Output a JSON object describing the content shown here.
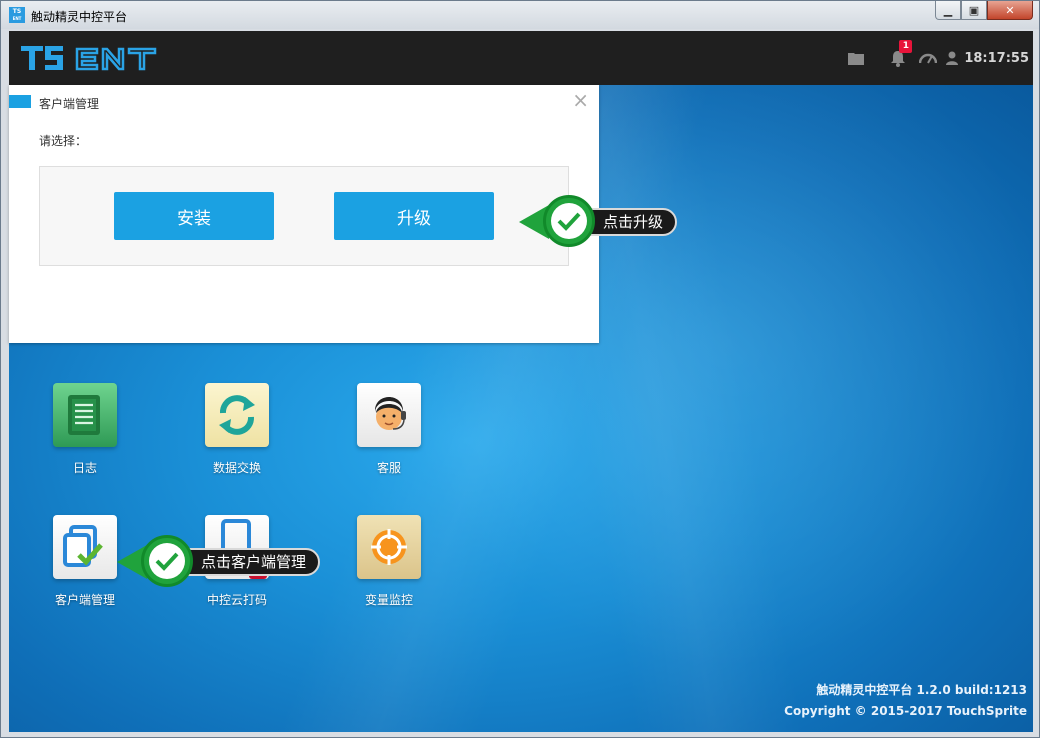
{
  "window": {
    "title": "触动精灵中控平台",
    "app_icon_text_top": "TS",
    "app_icon_text_bottom": "ENT"
  },
  "header": {
    "logo_text": "TS ENT",
    "notification_count": "1",
    "time": "18:17:55",
    "icons": [
      "folder-icon",
      "bell-icon",
      "gauge-icon",
      "user-icon"
    ]
  },
  "dialog": {
    "title": "客户端管理",
    "close_glyph": "×",
    "prompt": "请选择：",
    "buttons": {
      "install": "安装",
      "upgrade": "升级"
    }
  },
  "hints": {
    "upgrade": "点击升级",
    "client_manage": "点击客户端管理"
  },
  "desktop": {
    "apps": [
      {
        "label": "日志",
        "icon": "log-scroll-icon"
      },
      {
        "label": "数据交换",
        "icon": "sync-arrows-icon"
      },
      {
        "label": "客服",
        "icon": "support-agent-icon"
      },
      {
        "label": "客户端管理",
        "icon": "client-manage-icon"
      },
      {
        "label": "中控云打码",
        "icon": "cloud-captcha-icon"
      },
      {
        "label": "变量监控",
        "icon": "target-icon"
      }
    ]
  },
  "footer": {
    "version": "触动精灵中控平台 1.2.0 build:1213",
    "copyright": "Copyright © 2015-2017 TouchSprite"
  },
  "colors": {
    "accent": "#1ba1e2",
    "header_bg": "#1f1f1f",
    "badge": "#e8143a",
    "hint_green": "#20a33c"
  }
}
